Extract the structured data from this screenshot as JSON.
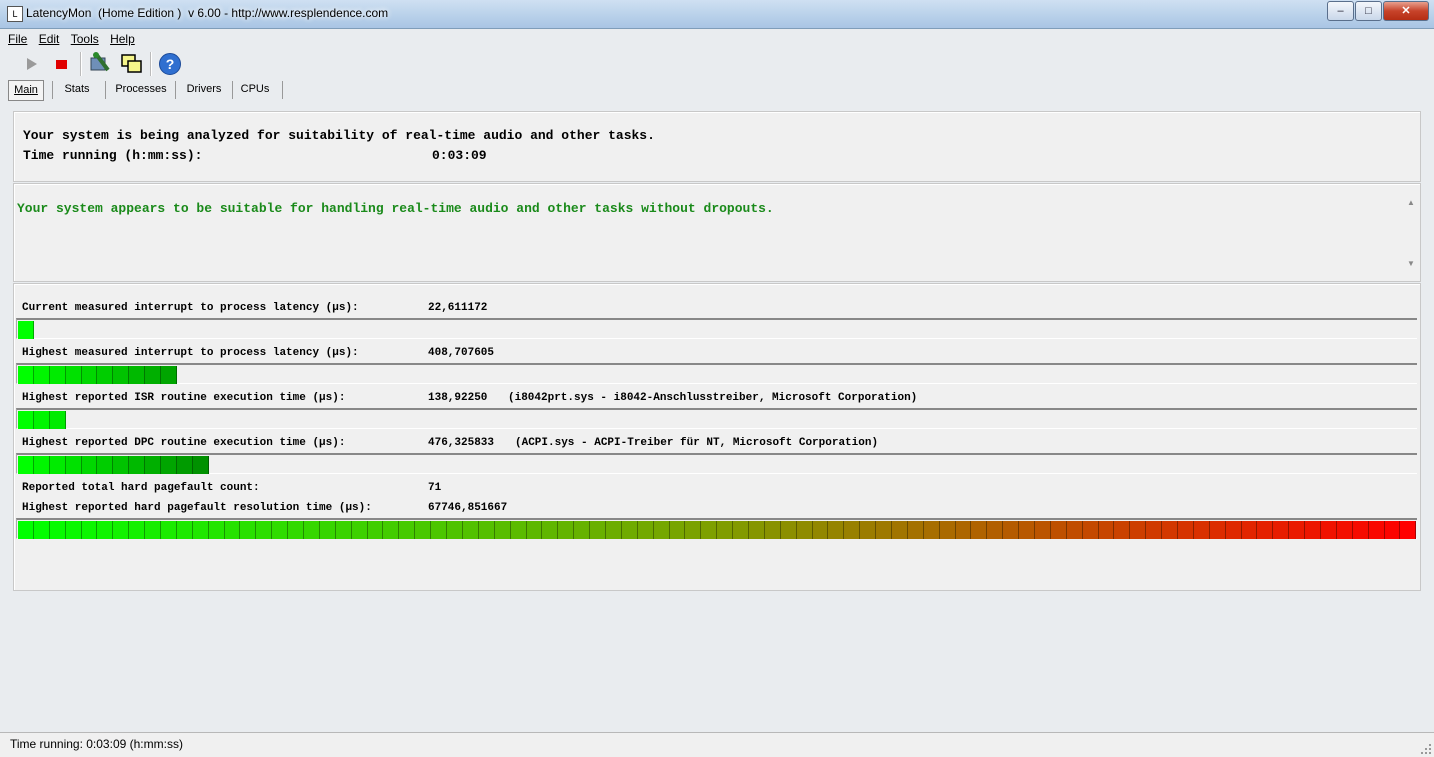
{
  "window": {
    "title": "LatencyMon  (Home Edition )  v 6.00 - http://www.resplendence.com",
    "app_icon": "latencymon-app-icon",
    "minimize": "0",
    "maximize": "1",
    "close": "r"
  },
  "menu": [
    {
      "label": "File"
    },
    {
      "label": "Edit"
    },
    {
      "label": "Tools"
    },
    {
      "label": "Help"
    }
  ],
  "toolbar": {
    "icons": [
      "play-icon",
      "stop-icon",
      "wrench-icon",
      "windows-icon",
      "help-icon"
    ],
    "help_glyph": "?"
  },
  "tabs": [
    {
      "label": "Main",
      "active": true
    },
    {
      "label": "Stats"
    },
    {
      "label": "Processes"
    },
    {
      "label": "Drivers"
    },
    {
      "label": "CPUs"
    }
  ],
  "analysis": {
    "line1": "Your system is being analyzed for suitability of real-time audio and other tasks.",
    "time_label": "Time running (h:mm:ss):",
    "time_value": "0:03:09"
  },
  "verdict": {
    "text": "Your system appears to be suitable for handling real-time audio and other tasks without dropouts.",
    "color": "#1a8a1a"
  },
  "metrics": [
    {
      "label": "Current measured interrupt to process latency (µs):",
      "value": "22,611172",
      "detail": "",
      "bar_segments": 1
    },
    {
      "label": "Highest measured interrupt to process latency (µs):",
      "value": "408,707605",
      "detail": "",
      "bar_segments": 10
    },
    {
      "label": "Highest reported ISR routine execution time (µs):",
      "value": "138,92250",
      "detail": "(i8042prt.sys - i8042-Anschlusstreiber, Microsoft Corporation)",
      "bar_segments": 3
    },
    {
      "label": "Highest reported DPC routine execution time (µs):",
      "value": "476,325833",
      "detail": "(ACPI.sys - ACPI-Treiber für NT, Microsoft Corporation)",
      "bar_segments": 12
    },
    {
      "label": "Reported total hard pagefault count:",
      "value": "71",
      "detail": ""
    },
    {
      "label": "Highest reported hard pagefault resolution time (µs):",
      "value": "67746,851667",
      "detail": "",
      "bar_segments": 88
    }
  ],
  "bar_colors": {
    "start": "#00ff00",
    "mid": "#7f9f00",
    "end": "#ff0000"
  },
  "status": {
    "text": "Time running: 0:03:09  (h:mm:ss)"
  }
}
